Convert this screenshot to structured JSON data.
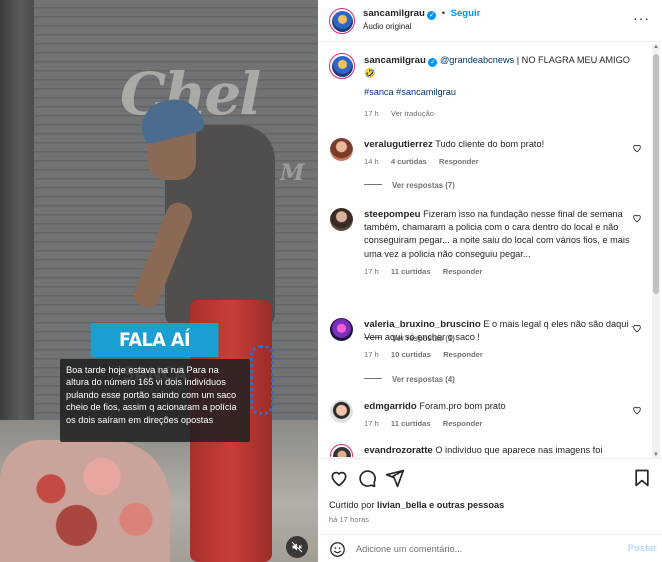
{
  "video": {
    "badge": "FALA AÍ SANCA",
    "caption": "Boa tarde hoje estava na rua Para na altura do número 165 vi dois indivíduos pulando esse portão saindo com um saco cheio de fios, assim q acionaram a polícia os dois saíram em direções opostas",
    "graffiti": "Chel",
    "graffiti2": "M"
  },
  "header": {
    "username": "sancamilgrau",
    "dot": "•",
    "follow": "Seguir",
    "audio": "Áudio original",
    "more": "···"
  },
  "post": {
    "username": "sancamilgrau",
    "mention": "@grandeabcnews",
    "text": " | NO FLAGRA MEU AMIGO",
    "emoji": "🤣",
    "hashtags": "#sanca #sancamilgrau",
    "time": "17 h",
    "translate": "Ver tradução"
  },
  "comments": [
    {
      "username": "veralugutierrez",
      "text": "Tudo cliente do bom prato!",
      "time": "14 h",
      "likes": "4 curtidas",
      "reply": "Responder",
      "view_replies": "Ver respostas (7)"
    },
    {
      "username": "steepompeu",
      "text": "Fizeram isso na fundação nesse final de semana também, chamaram a policia com o cara dentro do local e não conseguiram pegar... a noite saiu do local com vários fios, e mais uma vez a policia não conseguiu pegar...",
      "time": "17 h",
      "likes": "11 curtidas",
      "reply": "Responder",
      "view_replies": "Ver respostas (1)"
    },
    {
      "username": "valeria_bruxino_bruscino",
      "text": "E o mais legal q eles não são daqui . Vem aqui só encher o saco !",
      "time": "17 h",
      "likes": "10 curtidas",
      "reply": "Responder",
      "view_replies": "Ver respostas (4)"
    },
    {
      "username": "edmgarrido",
      "text": "Foram.pro bom prato",
      "time": "17 h",
      "likes": "11 curtidas",
      "reply": "Responder"
    },
    {
      "username": "evandrozoratte",
      "text": "O indivíduo que aparece nas imagens foi"
    }
  ],
  "footer": {
    "liked_by_prefix": "Curtido por ",
    "liked_by_user": "livian_bella",
    "liked_by_suffix": " e outras pessoas",
    "time_ago": "há 17 horas",
    "comment_placeholder": "Adicione um comentário...",
    "post_button": "Postar"
  },
  "colors": {
    "accent": "#0095f6",
    "badge": "#1a9fd0",
    "muted": "#737373"
  }
}
